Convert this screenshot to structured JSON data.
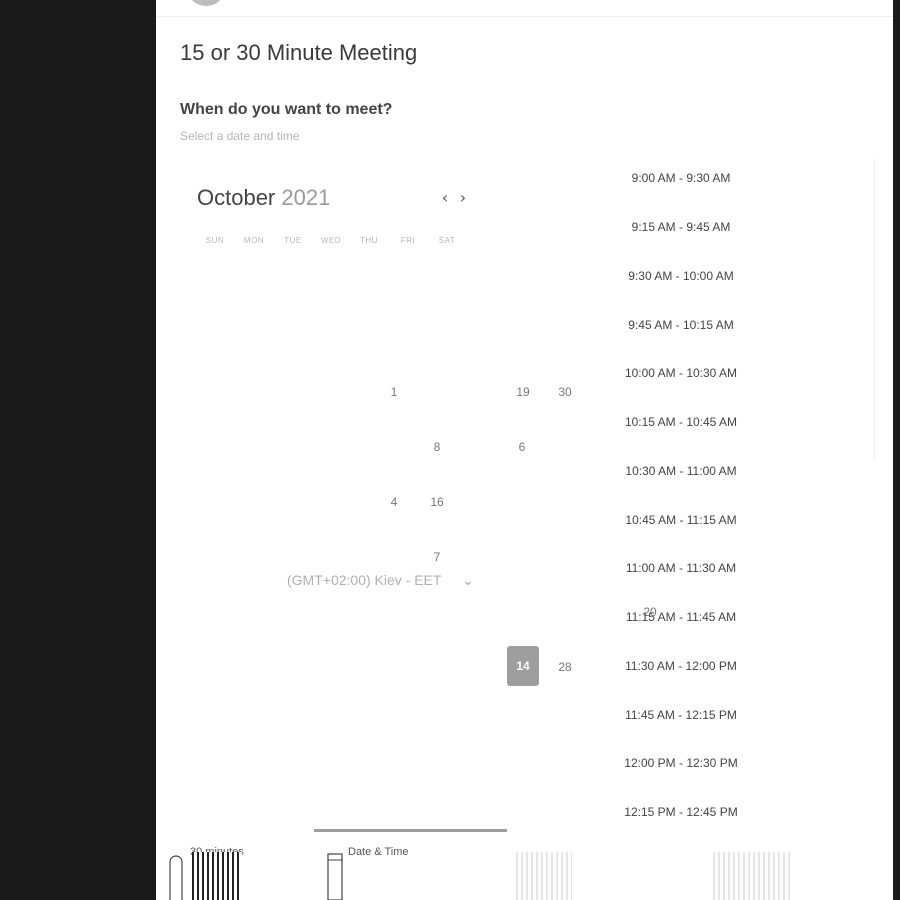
{
  "meeting": {
    "title": "15 or 30 Minute Meeting",
    "question": "When do you want to meet?",
    "subtitle": "Select a date and time"
  },
  "calendar": {
    "month": "October",
    "year": "2021",
    "prev_icon": "chevron-left-icon",
    "next_icon": "chevron-right-icon",
    "prev_label": "‹",
    "next_label": "›",
    "weekdays": [
      "SUN",
      "MON",
      "TUE",
      "WED",
      "THU",
      "FRI",
      "SAT"
    ],
    "days": [
      "1",
      "19",
      "30",
      "8",
      "6",
      "4",
      "16",
      "7",
      "20",
      "14",
      "28"
    ],
    "selected": "14"
  },
  "timezone": {
    "label": "(GMT+02:00) Kiev - EET",
    "chevron": "⌄",
    "chevron_icon": "chevron-down-icon"
  },
  "time_slots": [
    "9:00 AM - 9:30 AM",
    "9:15 AM - 9:45 AM",
    "9:30 AM - 10:00 AM",
    "9:45 AM - 10:15 AM",
    "10:00 AM - 10:30 AM",
    "10:15 AM - 10:45 AM",
    "10:30 AM - 11:00 AM",
    "10:45 AM - 11:15 AM",
    "11:00 AM - 11:30 AM",
    "11:15 AM - 11:45 AM",
    "11:30 AM - 12:00 PM",
    "11:45 AM - 12:15 PM",
    "12:00 PM - 12:30 PM",
    "12:15 PM - 12:45 PM"
  ],
  "steps": {
    "duration": "30 minutes",
    "datetime": "Date & Time",
    "duration_icon": "clock-icon",
    "datetime_icon": "calendar-icon"
  }
}
